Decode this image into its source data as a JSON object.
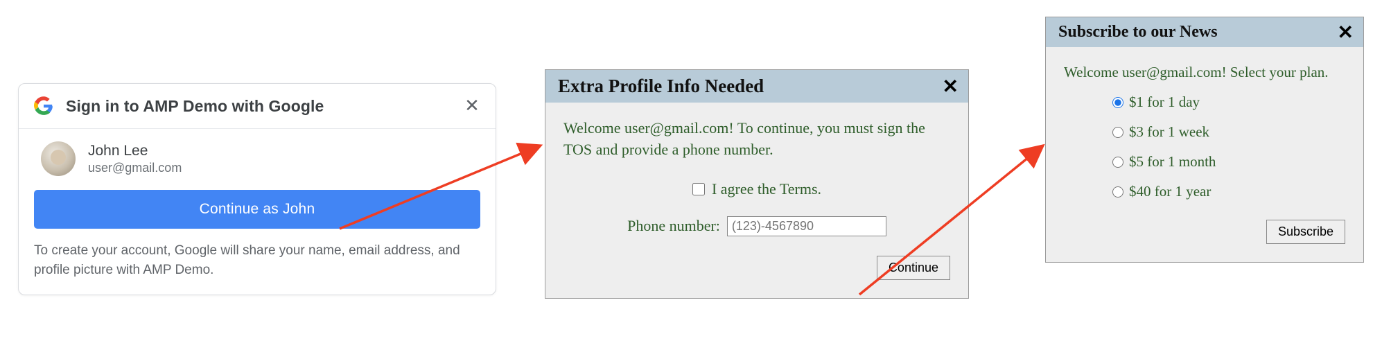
{
  "google": {
    "title": "Sign in to AMP Demo with Google",
    "user": {
      "name": "John Lee",
      "email": "user@gmail.com"
    },
    "continue_label": "Continue as John",
    "disclosure": "To create your account, Google will share your name, email address, and profile picture with AMP Demo."
  },
  "profile": {
    "title": "Extra Profile Info Needed",
    "welcome": "Welcome user@gmail.com! To continue, you must sign the TOS and provide a phone number.",
    "terms_label": "I agree the Terms.",
    "phone_label": "Phone number:",
    "phone_placeholder": "(123)-4567890",
    "continue_label": "Continue"
  },
  "subscribe": {
    "title": "Subscribe to our News",
    "welcome": "Welcome user@gmail.com! Select your plan.",
    "options": [
      "$1 for 1 day",
      "$3 for 1 week",
      "$5 for 1 month",
      "$40 for 1 year"
    ],
    "selected_index": 0,
    "subscribe_label": "Subscribe"
  },
  "colors": {
    "modal_header": "#b8cbd8",
    "modal_bg": "#eee",
    "accent_text": "#2e5d2a",
    "google_blue": "#4285f4",
    "arrow": "#ee3d23"
  }
}
